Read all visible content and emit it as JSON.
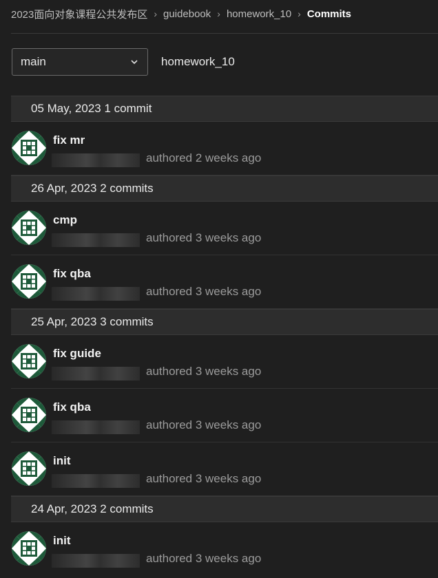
{
  "breadcrumb": [
    {
      "label": "2023面向对象课程公共发布区"
    },
    {
      "label": "guidebook"
    },
    {
      "label": "homework_10"
    },
    {
      "label": "Commits"
    }
  ],
  "branch": {
    "selected": "main",
    "path": "homework_10"
  },
  "groups": [
    {
      "header": "05 May, 2023 1 commit",
      "commits": [
        {
          "title": "fix mr",
          "meta": "authored 2 weeks ago"
        }
      ]
    },
    {
      "header": "26 Apr, 2023 2 commits",
      "commits": [
        {
          "title": "cmp",
          "meta": "authored 3 weeks ago"
        },
        {
          "title": "fix qba",
          "meta": "authored 3 weeks ago"
        }
      ]
    },
    {
      "header": "25 Apr, 2023 3 commits",
      "commits": [
        {
          "title": "fix guide",
          "meta": "authored 3 weeks ago"
        },
        {
          "title": "fix qba",
          "meta": "authored 3 weeks ago"
        },
        {
          "title": "init",
          "meta": "authored 3 weeks ago"
        }
      ]
    },
    {
      "header": "24 Apr, 2023 2 commits",
      "commits": [
        {
          "title": "init",
          "meta": "authored 3 weeks ago"
        }
      ]
    }
  ],
  "colors": {
    "avatar_green": "#1e5a3a",
    "avatar_light": "#ffffff"
  }
}
